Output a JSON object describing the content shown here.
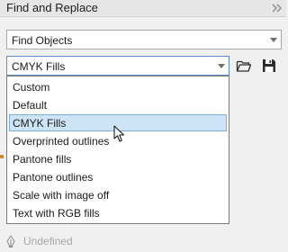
{
  "panel": {
    "title": "Find and Replace"
  },
  "find_combo": {
    "value": "Find Objects"
  },
  "preset_combo": {
    "value": "CMYK Fills"
  },
  "dropdown": {
    "options": [
      "Custom",
      "Default",
      "CMYK Fills",
      "Overprinted outlines",
      "Pantone fills",
      "Pantone outlines",
      "Scale with image off",
      "Text with RGB fills"
    ],
    "selected_index": 2
  },
  "status_row": {
    "text": "Undefined",
    "icon": "pen-nib-icon"
  },
  "colors": {
    "selection_bg": "#cde3f7",
    "selection_border": "#7aaee0",
    "focus_border": "#5a8ecf"
  }
}
